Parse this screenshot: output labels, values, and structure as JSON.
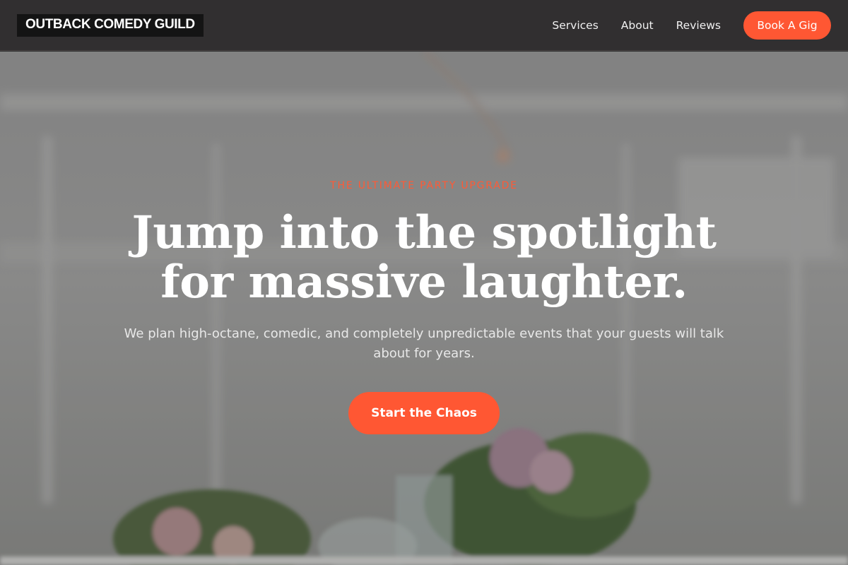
{
  "nav": {
    "logo": "OUTBACK COMEDY GUILD",
    "links": [
      {
        "label": "Services"
      },
      {
        "label": "About"
      },
      {
        "label": "Reviews"
      }
    ],
    "cta": "Book A Gig"
  },
  "hero": {
    "eyebrow": "THE ULTIMATE PARTY UPGRADE",
    "headline_line1": "Jump into the spotlight",
    "headline_line2": "for massive laughter.",
    "subtext": "We plan high-octane, comedic, and completely unpredictable events that your guests will talk about for years.",
    "cta": "Start the Chaos"
  },
  "colors": {
    "accent": "#ff5733",
    "nav_background": "#312f30",
    "logo_background": "#141414",
    "text_primary": "#ffffff"
  }
}
